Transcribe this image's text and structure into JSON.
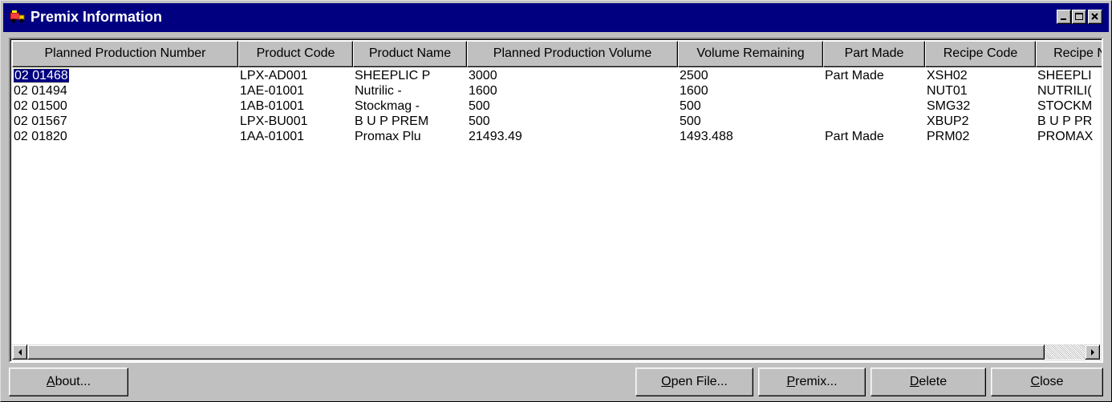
{
  "window": {
    "title": "Premix Information",
    "icon": "truck-icon",
    "controls": [
      "minimize-icon",
      "maximize-icon",
      "close-icon"
    ]
  },
  "listview": {
    "columns": [
      "Planned Production Number",
      "Product Code",
      "Product Name",
      "Planned Production Volume",
      "Volume Remaining",
      "Part Made",
      "Recipe Code",
      "Recipe N"
    ],
    "rows": [
      [
        "02 01468",
        "LPX-AD001",
        "SHEEPLIC P",
        "3000",
        "2500",
        "Part Made",
        "XSH02",
        "SHEEPLI"
      ],
      [
        "02 01494",
        "1AE-01001",
        "Nutrilic -",
        "1600",
        "1600",
        "",
        "NUT01",
        "NUTRILI("
      ],
      [
        "02 01500",
        "1AB-01001",
        "Stockmag -",
        "500",
        "500",
        "",
        "SMG32",
        "STOCKM"
      ],
      [
        "02 01567",
        "LPX-BU001",
        "B U P PREM",
        "500",
        "500",
        "",
        "XBUP2",
        "B U P PR"
      ],
      [
        "02 01820",
        "1AA-01001",
        "Promax Plu",
        "21493.49",
        "1493.488",
        "Part Made",
        "PRM02",
        "PROMAX"
      ]
    ],
    "selected_row": 0
  },
  "buttons": {
    "about": {
      "mnemonic": "A",
      "rest": "bout..."
    },
    "open_file": {
      "mnemonic": "O",
      "rest": "pen File..."
    },
    "premix": {
      "mnemonic": "P",
      "rest": "remix..."
    },
    "delete": {
      "mnemonic": "D",
      "rest": "elete"
    },
    "close": {
      "mnemonic": "C",
      "rest": "lose"
    }
  },
  "colors": {
    "titlebar": "#000080",
    "face": "#c0c0c0",
    "selection": "#000080"
  }
}
